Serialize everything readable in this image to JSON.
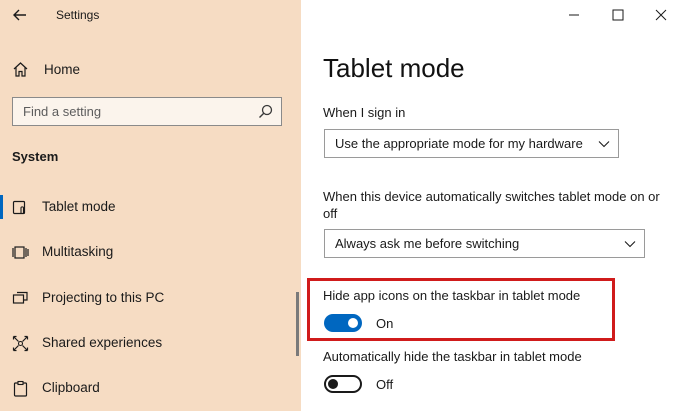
{
  "window": {
    "title": "Settings"
  },
  "sidebar": {
    "home_label": "Home",
    "search_placeholder": "Find a setting",
    "section_label": "System",
    "items": [
      {
        "label": "Tablet mode",
        "icon": "tablet-mode-icon",
        "selected": true
      },
      {
        "label": "Multitasking",
        "icon": "multitasking-icon"
      },
      {
        "label": "Projecting to this PC",
        "icon": "projecting-icon"
      },
      {
        "label": "Shared experiences",
        "icon": "shared-experiences-icon"
      },
      {
        "label": "Clipboard",
        "icon": "clipboard-icon"
      }
    ]
  },
  "main": {
    "title": "Tablet mode",
    "sign_in": {
      "label": "When I sign in",
      "value": "Use the appropriate mode for my hardware"
    },
    "switch": {
      "label": "When this device automatically switches tablet mode on or off",
      "value": "Always ask me before switching"
    },
    "hide_icons": {
      "label": "Hide app icons on the taskbar in tablet mode",
      "state": "On",
      "on": true
    },
    "hide_taskbar": {
      "label": "Automatically hide the taskbar in tablet mode",
      "state": "Off",
      "on": false
    }
  },
  "colors": {
    "sidebar_bg": "#f6dcc3",
    "accent": "#0067c0",
    "highlight_box": "#d01b1b"
  }
}
